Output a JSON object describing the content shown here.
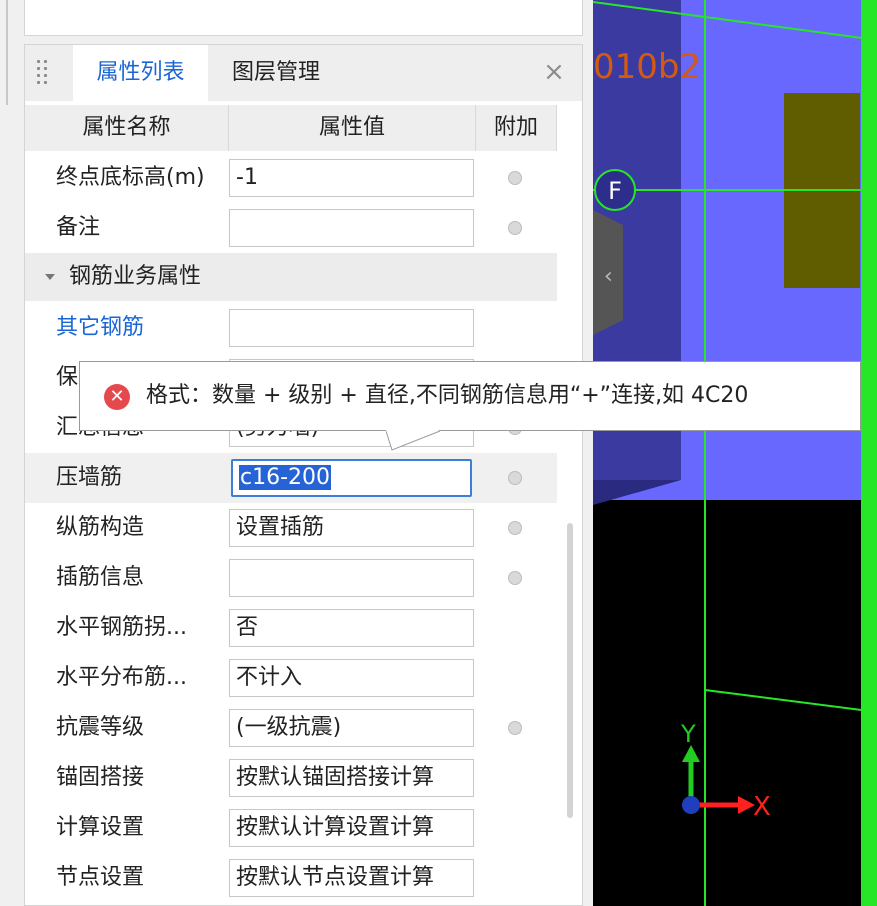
{
  "tabs": {
    "properties": "属性列表",
    "layers": "图层管理",
    "close": "×"
  },
  "columns": {
    "name": "属性名称",
    "value": "属性值",
    "extra": "附加"
  },
  "rows_top": [
    {
      "name": "终点底标高(m)",
      "value": "-1",
      "dot": true
    },
    {
      "name": "备注",
      "value": "",
      "dot": true
    }
  ],
  "section": "钢筋业务属性",
  "rows_main": [
    {
      "name": "其它钢筋",
      "value": "",
      "dot": false,
      "link": true
    },
    {
      "name": "保",
      "value": "",
      "dot": false
    },
    {
      "name": "汇总信息",
      "value": "(剪力墙)",
      "dot": true
    },
    {
      "name": "压墙筋",
      "value": "c16-200",
      "dot": true,
      "editing": true
    },
    {
      "name": "纵筋构造",
      "value": "设置插筋",
      "dot": true
    },
    {
      "name": "插筋信息",
      "value": "",
      "dot": true
    },
    {
      "name": "水平钢筋拐...",
      "value": "否",
      "dot": false
    },
    {
      "name": "水平分布筋...",
      "value": "不计入",
      "dot": false
    },
    {
      "name": "抗震等级",
      "value": "(一级抗震)",
      "dot": true
    },
    {
      "name": "锚固搭接",
      "value": "按默认锚固搭接计算",
      "dot": false
    },
    {
      "name": "计算设置",
      "value": "按默认计算设置计算",
      "dot": false
    },
    {
      "name": "节点设置",
      "value": "按默认节点设置计算",
      "dot": false
    }
  ],
  "tooltip": {
    "icon": "error-icon",
    "text": "格式：数量 + 级别 + 直径,不同钢筋信息用“+”连接,如 4C20"
  },
  "viewport": {
    "label_top": "010b2",
    "axis_label": "F",
    "collapse_glyph": "‹",
    "axis_x": "X",
    "axis_y": "Y",
    "colors": {
      "blue_fill": "#6868ff",
      "dark_band": "#3a3aa0",
      "olive": "#605c00",
      "green_line": "#27e627",
      "orange_text": "#d35a12",
      "background": "#000000"
    }
  }
}
